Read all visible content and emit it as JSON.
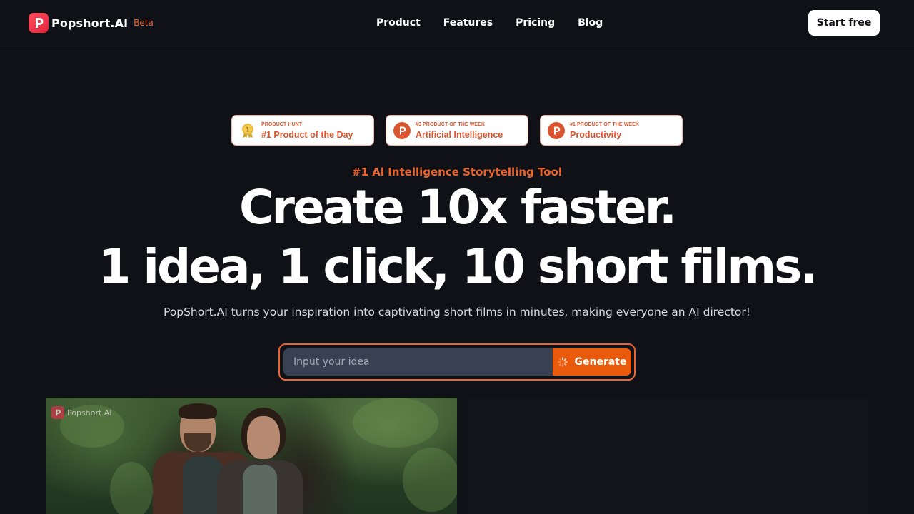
{
  "nav": {
    "brand_name": "Popshort.AI",
    "beta_label": "Beta",
    "links": [
      "Product",
      "Features",
      "Pricing",
      "Blog"
    ],
    "cta_label": "Start free"
  },
  "badges": [
    {
      "small": "PRODUCT HUNT",
      "big": "#1 Product of the Day",
      "icon": "medal-icon"
    },
    {
      "small": "#3 PRODUCT OF THE WEEK",
      "big": "Artificial Intelligence",
      "icon": "product-hunt-icon"
    },
    {
      "small": "#1 PRODUCT OF THE WEEK",
      "big": "Productivity",
      "icon": "product-hunt-icon"
    }
  ],
  "hero": {
    "eyebrow": "#1 Al Intelligence Storytelling Tool",
    "headline_line1": "Create 10x faster.",
    "headline_line2": "1 idea, 1 click, 10 short films.",
    "subtitle": "PopShort.AI turns your inspiration into captivating short films in minutes, making everyone an AI director!"
  },
  "idea": {
    "placeholder": "Input your idea",
    "value": "",
    "generate_label": "Generate"
  },
  "preview": {
    "watermark": "Popshort.AI"
  },
  "colors": {
    "background": "#0f1117",
    "accent": "#e9652d",
    "generate": "#ea5a0c",
    "badge_text": "#da552f",
    "input_bg": "#374151"
  }
}
